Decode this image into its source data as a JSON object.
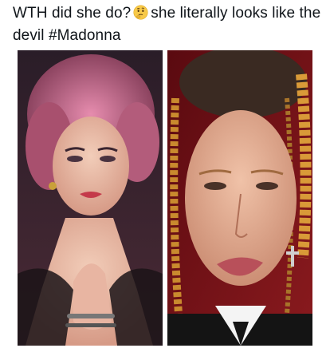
{
  "post": {
    "text_before_emoji": "WTH did she do?",
    "emoji": "thinking-face-emoji",
    "text_after_emoji": "she literally looks like the devil #Madonna"
  },
  "media": {
    "images": [
      {
        "name": "photo-left",
        "description_icon": "portrait-photo"
      },
      {
        "name": "photo-right",
        "description_icon": "portrait-photo"
      }
    ]
  },
  "colors": {
    "text": "#0f1419",
    "emoji_face": "#f7c948",
    "photo_left_bg": "#3a2430",
    "photo_right_bg": "#6b0f14"
  }
}
